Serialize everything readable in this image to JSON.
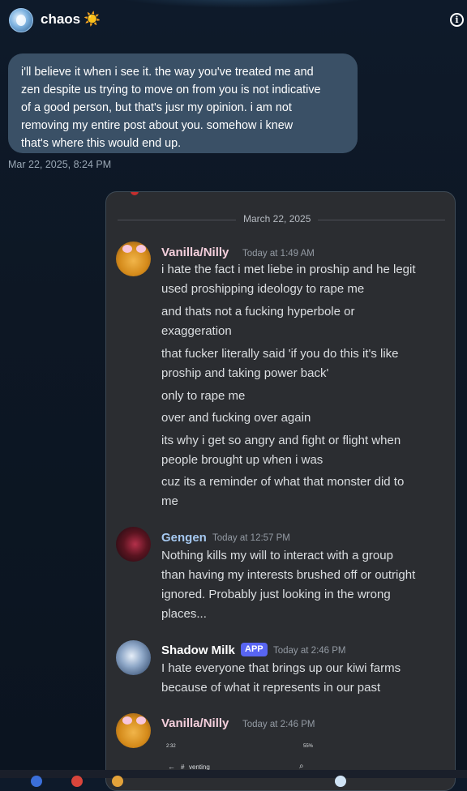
{
  "header": {
    "title": "chaos",
    "title_emoji": "☀️",
    "avatar_icon": "avatar-icon",
    "info_icon": "info-icon"
  },
  "message": {
    "lines": [
      "i'll believe it when i see it. the way you've treated me and",
      "zen despite us trying to move on from you is not indicative",
      "of a good person, but that's jusr my opinion. i am not",
      "removing my entire post about you. somehow i knew",
      "that's where this would end up."
    ],
    "timestamp": "Mar 22, 2025, 8:24 PM"
  },
  "screenshot": {
    "date_divider": "March 22, 2025",
    "messages": [
      {
        "author": "Vanilla/Nilly",
        "author_color": "#f4cfdc",
        "time": "Today at 1:49 AM",
        "lines": [
          "i hate the fact i met liebe in proship and he legit",
          "used proshipping ideology to rape me",
          "and thats not a fucking hyperbole or",
          "exaggeration",
          "that fucker literally said 'if you do this it's like",
          "proship and taking power back'",
          "only to rape me",
          "over and fucking over again",
          "its why i get so angry and fight or flight when",
          "people brought up when i was",
          "cuz its a reminder of what that monster did to",
          "me"
        ]
      },
      {
        "author": "Gengen",
        "author_color": "#a5c8f0",
        "time": "Today at 12:57 PM",
        "lines": [
          "Nothing kills my will to interact with a group",
          "than having my interests brushed off or outright",
          "ignored. Probably just looking in the wrong",
          "places..."
        ]
      },
      {
        "author": "Shadow Milk",
        "author_color": "#ffffff",
        "badge": "APP",
        "time": "Today at 2:46 PM",
        "lines": [
          "I hate everyone that brings up our kiwi farms",
          "because of what it represents in our past"
        ]
      },
      {
        "author": "Vanilla/Nilly",
        "author_color": "#f4cfdc",
        "time": "Today at 2:46 PM",
        "lines": []
      }
    ],
    "phone_status": {
      "time": "2:32",
      "battery": "55%",
      "channel": "venting"
    }
  },
  "colors": {
    "bubble": "#3a5066",
    "screenshot_bg": "#2b2d31",
    "app_badge": "#5865f2"
  }
}
